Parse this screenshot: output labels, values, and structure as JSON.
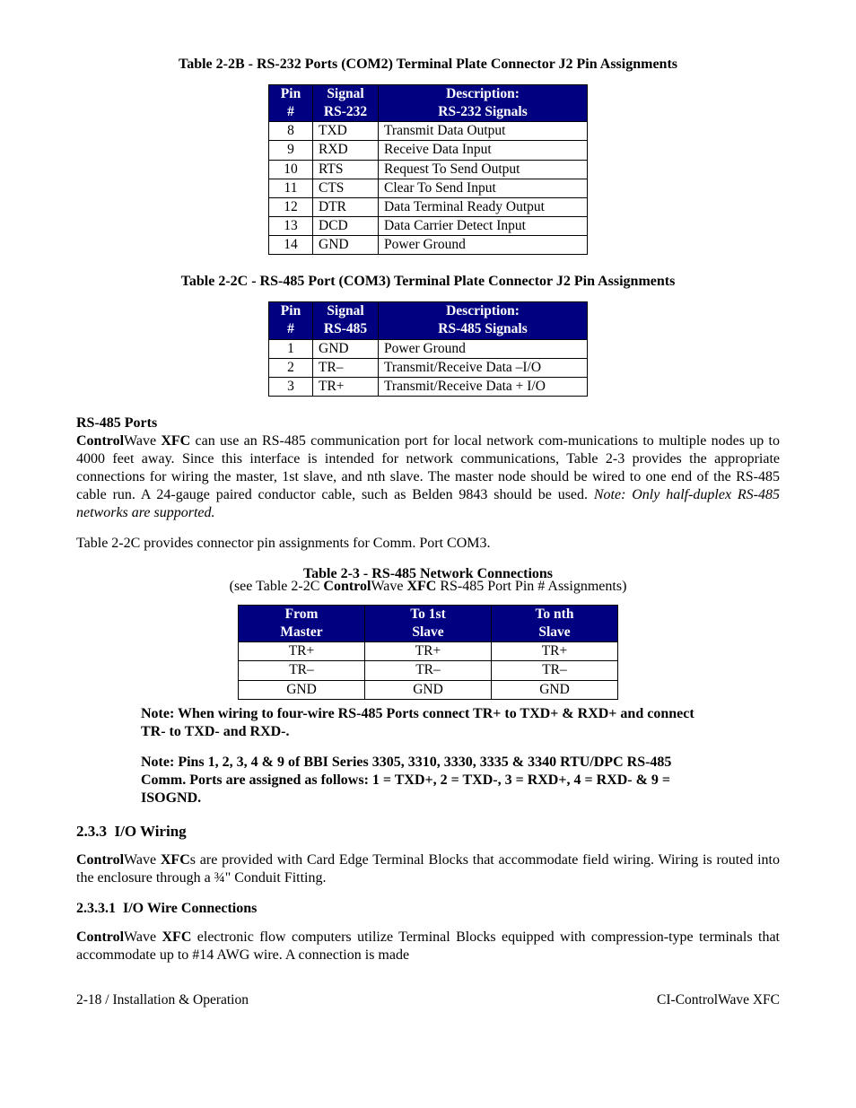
{
  "table2b": {
    "title": "Table 2-2B - RS-232 Ports (COM2) Terminal Plate Connector J2 Pin Assignments",
    "head": {
      "c1a": "Pin",
      "c1b": "#",
      "c2a": "Signal",
      "c2b": "RS-232",
      "c3a": "Description:",
      "c3b": "RS-232 Signals"
    },
    "rows": [
      {
        "pin": "8",
        "sig": "TXD",
        "desc": "Transmit Data Output"
      },
      {
        "pin": "9",
        "sig": "RXD",
        "desc": "Receive Data Input"
      },
      {
        "pin": "10",
        "sig": "RTS",
        "desc": "Request To Send Output"
      },
      {
        "pin": "11",
        "sig": "CTS",
        "desc": "Clear To Send Input"
      },
      {
        "pin": "12",
        "sig": "DTR",
        "desc": "Data Terminal Ready Output"
      },
      {
        "pin": "13",
        "sig": "DCD",
        "desc": "Data Carrier Detect Input"
      },
      {
        "pin": "14",
        "sig": "GND",
        "desc": "Power Ground"
      }
    ]
  },
  "table2c": {
    "title": "Table 2-2C - RS-485 Port (COM3) Terminal Plate Connector J2 Pin Assignments",
    "head": {
      "c1a": "Pin",
      "c1b": "#",
      "c2a": "Signal",
      "c2b": "RS-485",
      "c3a": "Description:",
      "c3b": "RS-485 Signals"
    },
    "rows": [
      {
        "pin": "1",
        "sig": "GND",
        "desc": "Power Ground"
      },
      {
        "pin": "2",
        "sig": "TR–",
        "desc": "Transmit/Receive Data –I/O"
      },
      {
        "pin": "3",
        "sig": "TR+",
        "desc": "Transmit/Receive Data + I/O"
      }
    ]
  },
  "rs485": {
    "heading": "RS-485 Ports",
    "cw_bold1": "Control",
    "cw_plain1": "Wave ",
    "cw_bold2": "XFC",
    "para1_rest": " can use an RS-485 communication port for local network com-munications to multiple nodes up to 4000 feet away. Since this interface is intended for network communications, Table 2-3 provides the appropriate connections for wiring the master, 1st slave, and nth slave. The master node should be wired to one end of the RS-485 cable run. A 24-gauge paired conductor cable, such as Belden 9843 should be used. ",
    "para1_note": "Note: Only half-duplex RS-485 networks are supported.",
    "para2": "Table 2-2C provides connector pin assignments for Comm. Port COM3."
  },
  "table23": {
    "title": "Table 2-3 - RS-485 Network Connections",
    "sub_pre": "(see Table 2-2C ",
    "sub_b1": "Control",
    "sub_mid": "Wave ",
    "sub_b2": "XFC",
    "sub_post": " RS-485 Port Pin # Assignments)",
    "head": {
      "c1a": "From",
      "c1b": "Master",
      "c2a": "To 1st",
      "c2b": "Slave",
      "c3a": "To nth",
      "c3b": "Slave"
    },
    "rows": [
      {
        "a": "TR+",
        "b": "TR+",
        "c": "TR+"
      },
      {
        "a": "TR–",
        "b": "TR–",
        "c": "TR–"
      },
      {
        "a": "GND",
        "b": "GND",
        "c": "GND"
      }
    ],
    "note1": "Note: When wiring to four-wire RS-485 Ports connect TR+ to TXD+ & RXD+ and connect TR- to TXD- and RXD-.",
    "note2": "Note: Pins 1, 2, 3, 4 & 9 of BBI Series 3305, 3310, 3330, 3335 & 3340 RTU/DPC RS-485 Comm. Ports are assigned as follows: 1 = TXD+, 2 = TXD-, 3 = RXD+, 4 = RXD- & 9 = ISOGND."
  },
  "sec233": {
    "num": "2.3.3",
    "title": "I/O Wiring",
    "cw_b1": "Control",
    "cw_p1": "Wave ",
    "cw_b2": "XFC",
    "rest": "s are provided with Card Edge Terminal Blocks that accommodate field wiring. Wiring is routed into the enclosure through a ¾\" Conduit Fitting."
  },
  "sec2331": {
    "num": "2.3.3.1",
    "title": "I/O Wire Connections",
    "cw_b1": "Control",
    "cw_p1": "Wave ",
    "cw_b2": "XFC",
    "rest": " electronic flow computers utilize Terminal Blocks equipped with compression-type terminals that accommodate up to #14 AWG wire. A connection is made"
  },
  "footer": {
    "left": "2-18 / Installation & Operation",
    "right": "CI-ControlWave XFC"
  }
}
